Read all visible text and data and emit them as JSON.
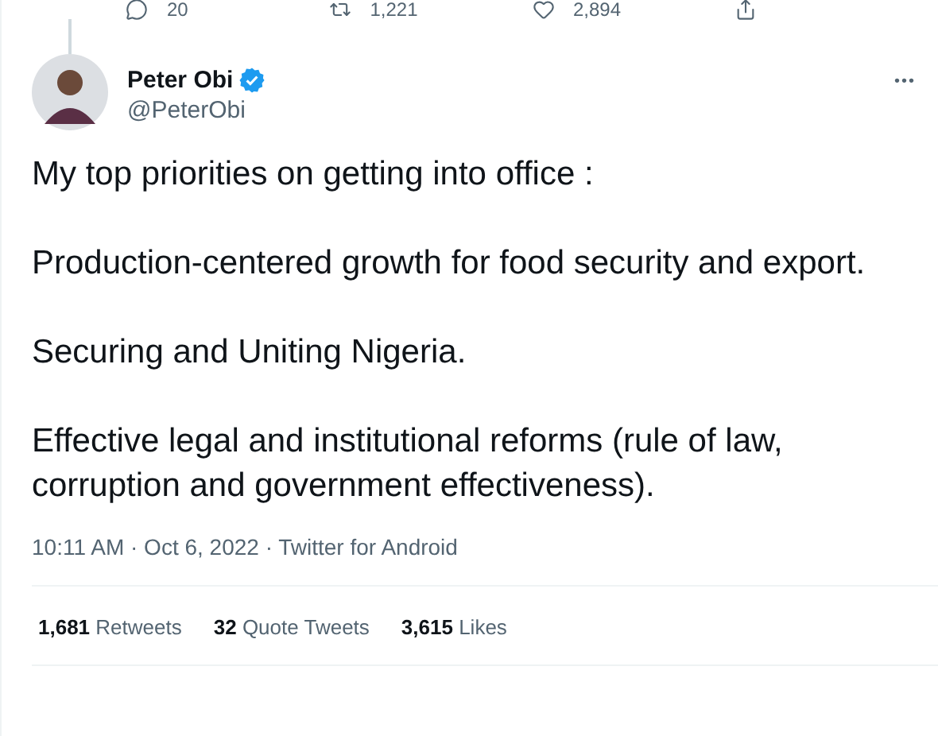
{
  "previous_tweet_actions": [
    {
      "kind": "reply",
      "count": "20"
    },
    {
      "kind": "retweet",
      "count": "1,221"
    },
    {
      "kind": "like",
      "count": "2,894"
    },
    {
      "kind": "share"
    }
  ],
  "tweet": {
    "author": {
      "name": "Peter Obi",
      "handle": "@PeterObi",
      "verified": true
    },
    "more": "•••",
    "paragraphs": [
      "My top priorities on getting into office :",
      "Production-centered growth for food security and export.",
      "Securing and Uniting Nigeria.",
      "Effective legal and institutional reforms (rule of law, corruption and government effectiveness)."
    ],
    "timestamp": "10:11 AM · Oct 6, 2022 · Twitter for Android",
    "stats": [
      "**1,681** Retweets",
      "**32** Quote Tweets",
      "**3,615** Likes"
    ]
  }
}
